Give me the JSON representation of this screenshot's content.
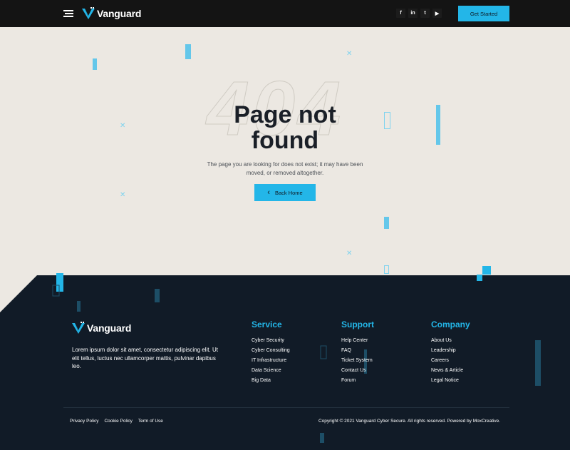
{
  "header": {
    "logo_text": "Vanguard",
    "social": [
      "f",
      "in",
      "t",
      "▶"
    ],
    "cta_label": "Get Started"
  },
  "hero": {
    "bg_number": "404",
    "title_line1": "Page not",
    "title_line2": "found",
    "description_line1": "The page you are looking for does not exist; it may have been",
    "description_line2": "moved, or removed altogether.",
    "back_icon": "‹",
    "back_label": "Back Home"
  },
  "footer": {
    "logo_text": "Vanguard",
    "description": "Lorem ipsum dolor sit amet, consectetur adipiscing elit. Ut elit tellus, luctus nec ullamcorper mattis, pulvinar dapibus leo.",
    "columns": [
      {
        "title": "Service",
        "links": [
          "Cyber Security",
          "Cyber Consulting",
          "IT Infrastructure",
          "Data Science",
          "Big Data"
        ]
      },
      {
        "title": "Support",
        "links": [
          "Help Center",
          "FAQ",
          "Ticket System",
          "Contact Us",
          "Forum"
        ]
      },
      {
        "title": "Company",
        "links": [
          "About Us",
          "Leadership",
          "Careers",
          "News & Article",
          "Legal Notice"
        ]
      }
    ],
    "legal": [
      "Privacy Policy",
      "Cookie Policy",
      "Term of Use"
    ],
    "copyright": "Copyright © 2021 Vanguard Cyber Secure. All rights reserved. Powered by MoxCreative."
  },
  "colors": {
    "accent": "#23b6e8",
    "header_bg": "#141414",
    "footer_bg": "#111b27",
    "page_bg": "#ece8e2"
  }
}
